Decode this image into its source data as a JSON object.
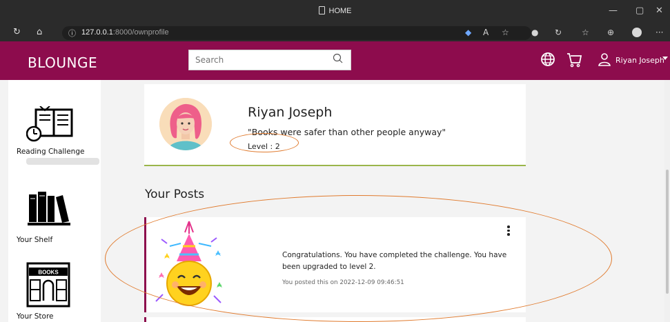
{
  "browser": {
    "tab_title": "HOME",
    "url_host": "127.0.0.1",
    "url_rest": ":8000/ownprofile",
    "url_icon": "info-icon"
  },
  "site": {
    "brand": "BLOUNGE",
    "search_placeholder": "Search",
    "username": "Riyan Joseph",
    "accent_color": "#8d0c4d"
  },
  "sidebar": {
    "items": [
      {
        "label": "Reading Challenge",
        "icon": "book-clock-icon",
        "progress": 0
      },
      {
        "label": "Your Shelf",
        "icon": "bookshelf-icon"
      },
      {
        "label": "Your Store",
        "icon": "bookstore-icon",
        "sign": "BOOKS"
      }
    ]
  },
  "profile": {
    "name": "Riyan Joseph",
    "quote": "\"Books were safer than other people anyway\"",
    "level": "Level : 2"
  },
  "posts": {
    "title": "Your Posts",
    "items": [
      {
        "text": "Congratulations. You have completed the challenge. You have been upgraded to level 2.",
        "meta": "You posted this on 2022-12-09 09:46:51",
        "image": "party-emoji-icon"
      }
    ]
  }
}
